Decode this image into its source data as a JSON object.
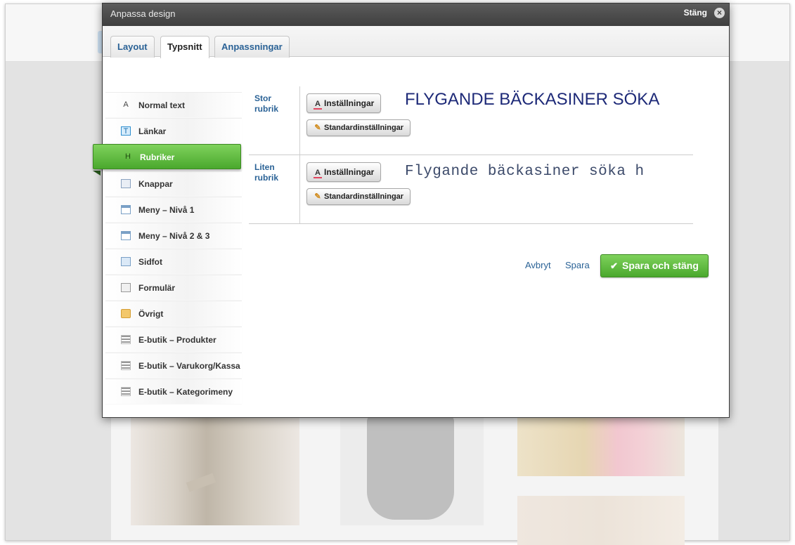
{
  "modal": {
    "title": "Anpassa design",
    "close_label": "Stäng",
    "close_icon": "close-icon"
  },
  "tabs": [
    {
      "label": "Layout",
      "active": false
    },
    {
      "label": "Typsnitt",
      "active": true
    },
    {
      "label": "Anpassningar",
      "active": false
    }
  ],
  "sidebar": {
    "items": [
      {
        "label": "Normal text",
        "icon": "font-icon",
        "glyph": "A",
        "active": false
      },
      {
        "label": "Länkar",
        "icon": "link-icon",
        "glyph": "T",
        "active": false
      },
      {
        "label": "Rubriker",
        "icon": "heading-icon",
        "glyph": "H",
        "active": true
      },
      {
        "label": "Knappar",
        "icon": "button-icon",
        "glyph": "",
        "active": false
      },
      {
        "label": "Meny – Nivå 1",
        "icon": "menu-icon",
        "glyph": "",
        "active": false
      },
      {
        "label": "Meny – Nivå 2 & 3",
        "icon": "menu-icon",
        "glyph": "",
        "active": false
      },
      {
        "label": "Sidfot",
        "icon": "footer-icon",
        "glyph": "",
        "active": false
      },
      {
        "label": "Formulär",
        "icon": "form-icon",
        "glyph": "",
        "active": false
      },
      {
        "label": "Övrigt",
        "icon": "folder-icon",
        "glyph": "",
        "active": false
      },
      {
        "label": "E-butik – Produkter",
        "icon": "list-icon",
        "glyph": "",
        "active": false
      },
      {
        "label": "E-butik – Varukorg/Kassa",
        "icon": "list-icon",
        "glyph": "",
        "active": false
      },
      {
        "label": "E-butik – Kategorimeny",
        "icon": "list-icon",
        "glyph": "",
        "active": false
      }
    ]
  },
  "headings": [
    {
      "label_line1": "Stor",
      "label_line2": "rubrik",
      "settings_label": "Inställningar",
      "settings_glyph": "A",
      "default_label": "Standardinställningar",
      "default_glyph": "✎",
      "preview": "FLYGANDE BÄCKASINER SÖKA"
    },
    {
      "label_line1": "Liten",
      "label_line2": "rubrik",
      "settings_label": "Inställningar",
      "settings_glyph": "A",
      "default_label": "Standardinställningar",
      "default_glyph": "✎",
      "preview": "Flygande bäckasiner söka h"
    }
  ],
  "actions": {
    "cancel_label": "Avbryt",
    "save_label": "Spara",
    "save_close_label": "Spara och stäng",
    "check_glyph": "✔"
  },
  "colors": {
    "accent_green": "#4aa82d",
    "link_blue": "#2a6296",
    "titlebar": "#3f3f3f"
  }
}
